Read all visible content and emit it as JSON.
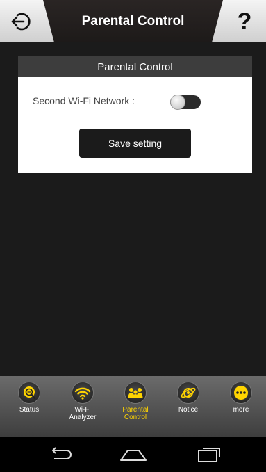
{
  "header": {
    "title": "Parental Control",
    "back_icon": "exit-arrow-icon",
    "help_label": "?"
  },
  "card": {
    "title": "Parental Control",
    "setting_label": "Second Wi-Fi Network :",
    "toggle_state": "off",
    "save_label": "Save setting"
  },
  "tabs": [
    {
      "label": "Status",
      "icon": "magnifier-icon",
      "active": false
    },
    {
      "label": "Wi-Fi\nAnalyzer",
      "icon": "wifi-icon",
      "active": false
    },
    {
      "label": "Parental\nControl",
      "icon": "family-icon",
      "active": true
    },
    {
      "label": "Notice",
      "icon": "planet-icon",
      "active": false
    },
    {
      "label": "more",
      "icon": "more-dots-icon",
      "active": false
    }
  ],
  "navbar": {
    "back_icon": "back-icon",
    "home_icon": "home-icon",
    "recents_icon": "recents-icon"
  },
  "colors": {
    "accent": "#ffd400",
    "header_bg": "#211d1c",
    "panel_bg": "#1b1b1b",
    "card_header_bg": "#3d3d3d",
    "tabbar_bg": "#5a5a5a"
  }
}
